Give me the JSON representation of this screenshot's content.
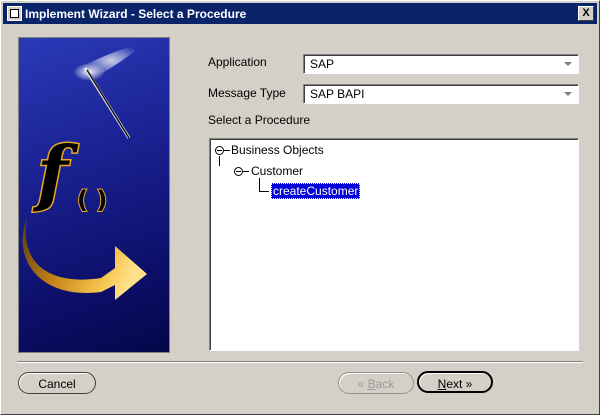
{
  "window": {
    "title": "Implement Wizard - Select a Procedure",
    "close_label": "X"
  },
  "form": {
    "application_label": "Application",
    "application_value": "SAP",
    "message_type_label": "Message Type",
    "message_type_value": "SAP BAPI",
    "procedure_label": "Select a Procedure"
  },
  "art": {
    "glyph_f": "f",
    "glyph_parens": "( )"
  },
  "tree": {
    "root_label": "Business Objects",
    "child_label": "Customer",
    "leaf_label": "createCustomer"
  },
  "buttons": {
    "cancel_label": "Cancel",
    "back_label": "Back",
    "back_mnemonic": "B",
    "back_rest": "ack",
    "back_arrow": "«",
    "next_mnemonic": "N",
    "next_rest": "ext",
    "next_arrow": "»"
  },
  "colors": {
    "titlebar": "#0a246a",
    "selection": "#0000d8",
    "art_background": "#1c2496",
    "arrow_gold": "#e8a820"
  }
}
